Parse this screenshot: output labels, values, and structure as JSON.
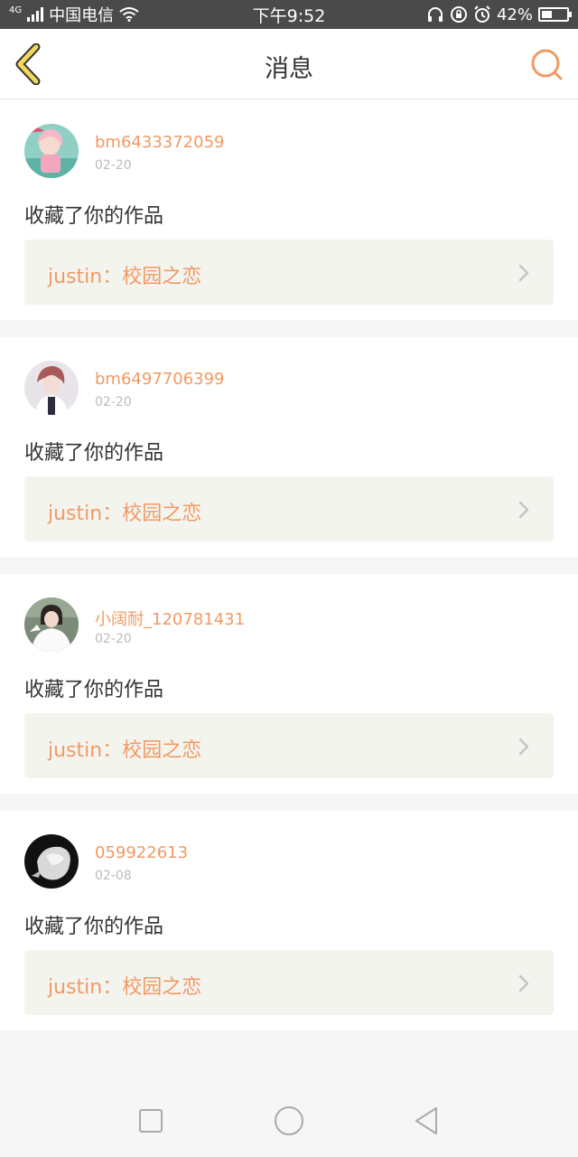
{
  "status_bar": {
    "network": "4G",
    "carrier": "中国电信",
    "time": "下午9:52",
    "battery": "42%",
    "battery_level": 0.42
  },
  "header": {
    "title": "消息",
    "back_icon": "chevron-left-icon",
    "search_icon": "search-icon"
  },
  "colors": {
    "accent": "#f19a64",
    "back_icon": "#f2d85a",
    "text": "#333333",
    "muted": "#bcbcbc",
    "card_inner": "#f4f4ef"
  },
  "messages": [
    {
      "username": "bm6433372059",
      "date": "02-20",
      "action": "收藏了你的作品",
      "work": "justin：校园之恋"
    },
    {
      "username": "bm6497706399",
      "date": "02-20",
      "action": "收藏了你的作品",
      "work": "justin：校园之恋"
    },
    {
      "username": "小阔耐_120781431",
      "date": "02-20",
      "action": "收藏了你的作品",
      "work": "justin：校园之恋"
    },
    {
      "username": "059922613",
      "date": "02-08",
      "action": "收藏了你的作品",
      "work": "justin：校园之恋"
    }
  ],
  "nav_bar": {
    "recents_icon": "square-icon",
    "home_icon": "circle-icon",
    "back_icon": "triangle-back-icon"
  }
}
